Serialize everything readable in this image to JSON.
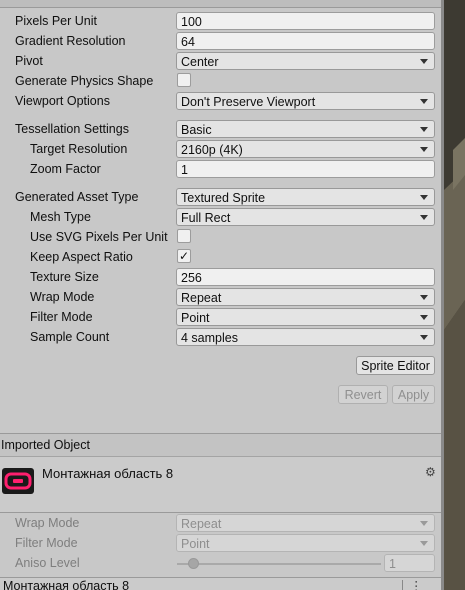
{
  "settings": {
    "pixels_per_unit": {
      "label": "Pixels Per Unit",
      "value": "100"
    },
    "gradient_resolution": {
      "label": "Gradient Resolution",
      "value": "64"
    },
    "pivot": {
      "label": "Pivot",
      "value": "Center"
    },
    "generate_physics_shape": {
      "label": "Generate Physics Shape",
      "checked": false
    },
    "viewport_options": {
      "label": "Viewport Options",
      "value": "Don't Preserve Viewport"
    },
    "tessellation_settings": {
      "label": "Tessellation Settings",
      "value": "Basic"
    },
    "target_resolution": {
      "label": "Target Resolution",
      "value": "2160p (4K)"
    },
    "zoom_factor": {
      "label": "Zoom Factor",
      "value": "1"
    },
    "generated_asset_type": {
      "label": "Generated Asset Type",
      "value": "Textured Sprite"
    },
    "mesh_type": {
      "label": "Mesh Type",
      "value": "Full Rect"
    },
    "use_svg_pixels_per_unit": {
      "label": "Use SVG Pixels Per Unit",
      "checked": false
    },
    "keep_aspect_ratio": {
      "label": "Keep Aspect Ratio",
      "checked": true,
      "mark": "✓"
    },
    "texture_size": {
      "label": "Texture Size",
      "value": "256"
    },
    "wrap_mode": {
      "label": "Wrap Mode",
      "value": "Repeat"
    },
    "filter_mode": {
      "label": "Filter Mode",
      "value": "Point"
    },
    "sample_count": {
      "label": "Sample Count",
      "value": "4 samples"
    }
  },
  "buttons": {
    "sprite_editor": "Sprite Editor",
    "revert": "Revert",
    "apply": "Apply"
  },
  "imported_object": {
    "header": "Imported Object",
    "asset_name": "Монтажная область 8",
    "thumbnail_icon": "pink-rounded-rect-icon",
    "gear_icon": "⚙",
    "thumbnail_color": "#ff1f6e"
  },
  "preview_settings": {
    "wrap_mode": {
      "label": "Wrap Mode",
      "value": "Repeat"
    },
    "filter_mode": {
      "label": "Filter Mode",
      "value": "Point"
    },
    "aniso_level": {
      "label": "Aniso Level",
      "value": "1"
    }
  },
  "bottom_bar": {
    "title": "Монтажная область 8",
    "menu_icon": "⋮"
  }
}
